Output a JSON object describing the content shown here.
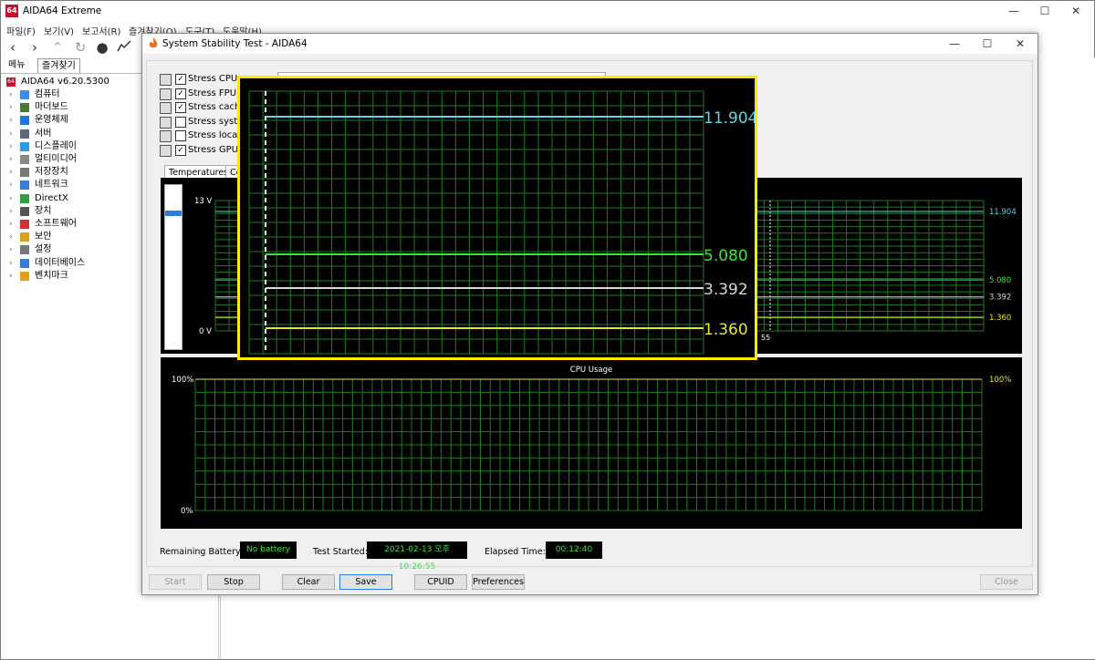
{
  "main": {
    "title": "AIDA64 Extreme",
    "app_icon": "64",
    "window_controls": {
      "minimize": "—",
      "maximize": "☐",
      "close": "✕"
    },
    "menu": [
      "파일(F)",
      "보기(V)",
      "보고서(R)",
      "즐겨찾기(O)",
      "도구(T)",
      "도움말(H)"
    ],
    "toolbar_icons": [
      "back-icon",
      "forward-icon",
      "up-icon",
      "refresh-icon",
      "user-icon",
      "chart-icon"
    ]
  },
  "left_panel": {
    "tabs": [
      "메뉴",
      "즐겨찾기"
    ],
    "root": "AIDA64 v6.20.5300",
    "items": [
      {
        "label": "컴퓨터",
        "color": "#3a8ee6"
      },
      {
        "label": "마더보드",
        "color": "#4a7a3a"
      },
      {
        "label": "운영체제",
        "color": "#1e78d7"
      },
      {
        "label": "서버",
        "color": "#5a6a7a"
      },
      {
        "label": "디스플레이",
        "color": "#2d9be0"
      },
      {
        "label": "멀티미디어",
        "color": "#888888"
      },
      {
        "label": "저장장치",
        "color": "#777777"
      },
      {
        "label": "네트워크",
        "color": "#3a7bd5"
      },
      {
        "label": "DirectX",
        "color": "#2e9e44"
      },
      {
        "label": "장치",
        "color": "#555555"
      },
      {
        "label": "소프트웨어",
        "color": "#cc3333"
      },
      {
        "label": "보안",
        "color": "#d9a21b"
      },
      {
        "label": "설정",
        "color": "#777777"
      },
      {
        "label": "데이터베이스",
        "color": "#3a7bd5"
      },
      {
        "label": "벤치마크",
        "color": "#e0a020"
      }
    ]
  },
  "dialog": {
    "title": "System Stability Test - AIDA64",
    "window_controls": {
      "minimize": "—",
      "maximize": "☐",
      "close": "✕"
    },
    "stress_options": [
      {
        "label": "Stress CPU",
        "checked": true
      },
      {
        "label": "Stress FPU",
        "checked": true
      },
      {
        "label": "Stress cache",
        "checked": true
      },
      {
        "label": "Stress system",
        "checked": false
      },
      {
        "label": "Stress local dis",
        "checked": false
      },
      {
        "label": "Stress GPU(s)",
        "checked": true
      }
    ],
    "graph_tabs": [
      "Temperatures",
      "Coo"
    ],
    "status": {
      "battery_label": "Remaining Battery:",
      "battery_value": "No battery",
      "started_label": "Test Started:",
      "started_value": "2021-02-13 오후 10:26:55",
      "elapsed_label": "Elapsed Time:",
      "elapsed_value": "00:12:40"
    },
    "buttons": {
      "start": "Start",
      "stop": "Stop",
      "clear": "Clear",
      "save": "Save",
      "cpuid": "CPUID",
      "preferences": "Preferences",
      "close": "Close"
    }
  },
  "chart_data": [
    {
      "type": "line",
      "title": "",
      "ylabel": "",
      "y_top_label": "13 V",
      "y_bottom_label": "0 V",
      "ylim": [
        0,
        13
      ],
      "x_tick_label": "55",
      "grid": true,
      "series": [
        {
          "values": [
            11.904
          ],
          "color": "#5fd6e6",
          "label": "11.904"
        },
        {
          "values": [
            5.08
          ],
          "color": "#39e639",
          "label": "5.080"
        },
        {
          "values": [
            3.392
          ],
          "color": "#d8d8d8",
          "label": "3.392"
        },
        {
          "values": [
            1.36
          ],
          "color": "#e6e62e",
          "label": "1.360"
        }
      ]
    },
    {
      "type": "line",
      "title": "CPU Usage",
      "y_top_label": "100%",
      "y_bottom_label": "0%",
      "ylim": [
        0,
        100
      ],
      "grid": true,
      "series": [
        {
          "values": [
            100
          ],
          "color": "#e6e62e",
          "label": "100%"
        }
      ]
    }
  ],
  "zoom_inset": {
    "border_color": "#ffe800",
    "labels": [
      "11.904",
      "5.080",
      "3.392",
      "1.360"
    ]
  }
}
